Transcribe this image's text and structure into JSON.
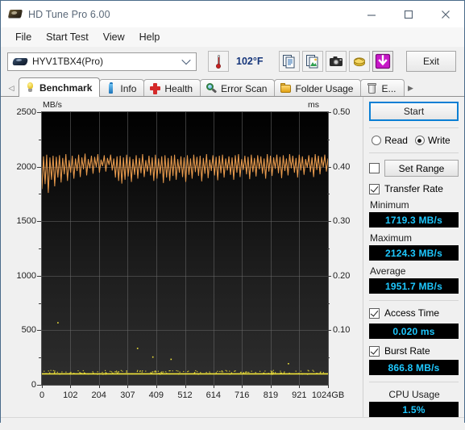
{
  "window": {
    "title": "HD Tune Pro 6.00",
    "app_icon": "hard-disk-icon",
    "minimize": "—",
    "maximize": "□",
    "close": "✕"
  },
  "menu": {
    "items": [
      {
        "label": "File"
      },
      {
        "label": "Start Test"
      },
      {
        "label": "View"
      },
      {
        "label": "Help"
      }
    ]
  },
  "toolbar": {
    "drive": {
      "value": "HYV1TBX4(Pro)",
      "icon": "hard-disk-icon",
      "chevron": "chevron-down-icon"
    },
    "temperature": {
      "value": "102°F",
      "icon": "thermometer-icon",
      "color": "#15357a"
    },
    "buttons": [
      {
        "name": "copy-text-button",
        "icon": "copy-text-icon"
      },
      {
        "name": "copy-image-button",
        "icon": "copy-image-icon"
      },
      {
        "name": "screenshot-button",
        "icon": "camera-icon"
      },
      {
        "name": "options-button",
        "icon": "hand-coins-icon"
      },
      {
        "name": "save-button",
        "icon": "download-arrow-icon"
      }
    ],
    "exit_label": "Exit"
  },
  "tabs": {
    "scroll_left": "◁",
    "scroll_right": "▶",
    "items": [
      {
        "label": "Benchmark",
        "icon": "lightbulb-icon",
        "active": true
      },
      {
        "label": "Info",
        "icon": "info-icon",
        "active": false
      },
      {
        "label": "Health",
        "icon": "red-cross-icon",
        "active": false
      },
      {
        "label": "Error Scan",
        "icon": "magnifier-icon",
        "active": false
      },
      {
        "label": "Folder Usage",
        "icon": "folder-icon",
        "active": false
      },
      {
        "label": "E...",
        "icon": "trash-icon",
        "active": false
      }
    ]
  },
  "panel": {
    "start_label": "Start",
    "mode": {
      "read_label": "Read",
      "write_label": "Write",
      "selected": "Write"
    },
    "set_range": {
      "label": "Set Range",
      "checked": false
    },
    "transfer_rate": {
      "label": "Transfer Rate",
      "checked": true
    },
    "minimum": {
      "label": "Minimum",
      "value": "1719.3 MB/s"
    },
    "maximum": {
      "label": "Maximum",
      "value": "2124.3 MB/s"
    },
    "average": {
      "label": "Average",
      "value": "1951.7 MB/s"
    },
    "access_time": {
      "label": "Access Time",
      "checked": true,
      "value": "0.020 ms"
    },
    "burst_rate": {
      "label": "Burst Rate",
      "checked": true,
      "value": "866.8 MB/s"
    },
    "cpu_usage": {
      "label": "CPU Usage",
      "value": "1.5%"
    }
  },
  "chart_data": {
    "type": "line",
    "title": "",
    "xlabel": "",
    "ylabel": "MB/s",
    "y2label": "ms",
    "grid": true,
    "legend": null,
    "xlim": [
      0,
      1024
    ],
    "ylim": [
      0,
      2500
    ],
    "y2lim": [
      0,
      0.5
    ],
    "x_ticklabels": [
      "0",
      "102",
      "204",
      "307",
      "409",
      "512",
      "614",
      "716",
      "819",
      "921",
      "1024GB"
    ],
    "x_tickvalues": [
      0,
      102,
      204,
      307,
      409,
      512,
      614,
      716,
      819,
      921,
      1024
    ],
    "y_ticklabels": [
      "0",
      "500",
      "1000",
      "1500",
      "2000",
      "2500"
    ],
    "y_tickvalues": [
      0,
      500,
      1000,
      1500,
      2000,
      2500
    ],
    "y2_ticklabels": [
      "0.10",
      "0.20",
      "0.30",
      "0.40",
      "0.50"
    ],
    "y2_tickvalues": [
      0.1,
      0.2,
      0.3,
      0.4,
      0.5
    ],
    "plot_bgcolor": "#0a0a0a",
    "series": [
      {
        "name": "Transfer Rate",
        "axis": "left",
        "color": "#f0a050",
        "units": "MB/s",
        "summary": {
          "minimum": 1719.3,
          "maximum": 2124.3,
          "average": 1951.7
        },
        "band_low": 1850,
        "band_high": 2130,
        "values": [
          1795,
          2095,
          1840,
          2110,
          1760,
          2085,
          1880,
          2100,
          1820,
          2090,
          1900,
          2105,
          1855,
          2080,
          1930,
          2115,
          1870,
          2060,
          1945,
          2100,
          1890,
          2075,
          1960,
          2110,
          1905,
          2085,
          1975,
          2120,
          1920,
          2070,
          1985,
          2100,
          1935,
          2090,
          1995,
          2115,
          1945,
          2065,
          2005,
          2105,
          1955,
          2080,
          2015,
          2110,
          1965,
          2075,
          1900,
          2095,
          1870,
          2100,
          1845,
          2085,
          1880,
          2110,
          1910,
          2090,
          1860,
          2070,
          1925,
          2105,
          1890,
          2080,
          1940,
          2115,
          1905,
          2060,
          1955,
          2100,
          1920,
          2085,
          1870,
          2110,
          1890,
          2075,
          1935,
          2095,
          1850,
          2105,
          1900,
          2080,
          1870,
          2100,
          1915,
          2110,
          1880,
          2070,
          1945,
          2095,
          1905,
          2085,
          1860,
          2105,
          1925,
          2075,
          1890,
          2110,
          1950,
          2090,
          1915,
          2100,
          1865,
          2080,
          1935,
          2115,
          1895,
          2065,
          1960,
          2105,
          1920,
          2090,
          1875,
          2100,
          1940,
          2110,
          1900,
          2075,
          1965,
          2095,
          1925,
          2085,
          1880,
          2105,
          1945,
          2115,
          1905,
          2070,
          1970,
          2100,
          1930,
          2090,
          1885,
          2110,
          1950,
          2080,
          1910,
          2105,
          1975,
          2095,
          1935,
          2075,
          1890,
          2115,
          1955,
          2100,
          1915,
          2085,
          1980,
          2110,
          1940,
          2090,
          1895,
          2105,
          1960,
          2075,
          1920,
          2115,
          1985,
          2100,
          1945,
          2080,
          1900,
          2110,
          1965,
          2095,
          1925,
          2070,
          1990,
          2105,
          1950,
          2085,
          1905,
          2115,
          1970,
          2100,
          1930,
          2090,
          1995,
          2110,
          1955,
          2075
        ]
      },
      {
        "name": "Access Time",
        "axis": "right",
        "color": "#f2e53a",
        "units": "ms",
        "summary": {
          "average": 0.02
        },
        "baseline": 0.02,
        "outliers": [
          {
            "x": 55,
            "y": 0.115
          },
          {
            "x": 340,
            "y": 0.068
          },
          {
            "x": 395,
            "y": 0.052
          },
          {
            "x": 460,
            "y": 0.048
          },
          {
            "x": 880,
            "y": 0.04
          }
        ]
      }
    ]
  }
}
